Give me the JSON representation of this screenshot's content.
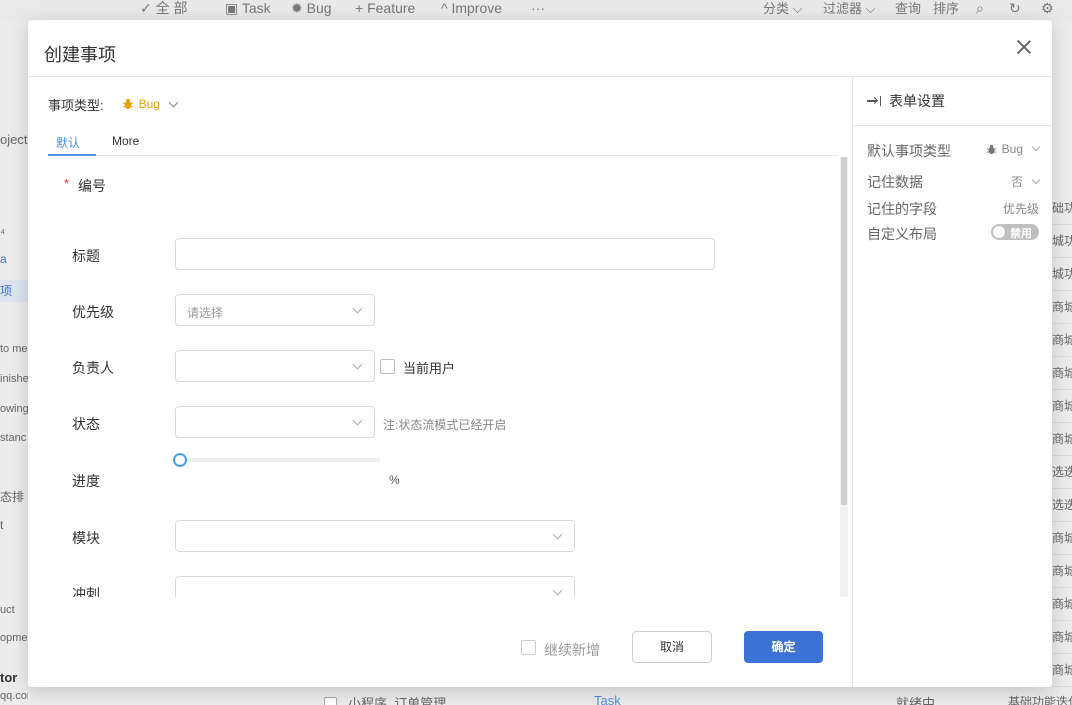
{
  "background": {
    "toolbar_items": [
      {
        "label": "全 部",
        "icon": "check-all-icon"
      },
      {
        "label": "Task",
        "icon": "clipboard-icon"
      },
      {
        "label": "Bug",
        "icon": "bug-icon"
      },
      {
        "label": "Feature",
        "icon": "plus-icon"
      },
      {
        "label": "Improve",
        "icon": "caret-up-icon"
      },
      {
        "label": "···",
        "icon": "more-icon"
      }
    ],
    "toolbar_right": [
      "分类",
      "过滤器",
      "查询",
      "排序"
    ],
    "left_items": [
      "oject",
      "⁴",
      "a",
      "项",
      "to me",
      "inishe",
      "owing",
      "stanc",
      "态排",
      "t",
      "uct",
      "opme",
      "tor",
      "qq.com"
    ],
    "right_items": [
      "础功能",
      "城功能",
      "城功能",
      "商城项",
      "商城项",
      "商城项",
      "商城项",
      "商城项",
      "选迭代",
      "选迭代",
      "商城项",
      "商城项",
      "商城项",
      "商城项",
      "商城项"
    ],
    "bottom_row": {
      "title": "小程序_订单管理",
      "type": "Task",
      "status": "就绪中",
      "module": "基础功能迭代"
    }
  },
  "modal": {
    "title": "创建事项",
    "type_label": "事项类型:",
    "type_value": "Bug",
    "tabs": [
      {
        "label": "默认",
        "active": true
      },
      {
        "label": "More",
        "active": false
      }
    ],
    "fields": {
      "bianhao": {
        "label": "编号",
        "required": true
      },
      "title": {
        "label": "标题",
        "value": ""
      },
      "priority": {
        "label": "优先级",
        "placeholder": "请选择"
      },
      "assignee": {
        "label": "负责人",
        "value": "",
        "checkbox_label": "当前用户"
      },
      "status": {
        "label": "状态",
        "value": "",
        "note": "注:状态流模式已经开启"
      },
      "progress": {
        "label": "进度",
        "value": 0,
        "unit": "%"
      },
      "module": {
        "label": "模块",
        "value": ""
      },
      "sprint": {
        "label": "冲刺",
        "value": ""
      }
    },
    "footer": {
      "continue_label": "继续新增",
      "cancel_label": "取消",
      "ok_label": "确定"
    },
    "settings": {
      "title": "表单设置",
      "rows": [
        {
          "label": "默认事项类型",
          "value": "Bug"
        },
        {
          "label": "记住数据",
          "value": "否"
        },
        {
          "label": "记住的字段",
          "value": "优先级"
        },
        {
          "label": "自定义布局",
          "toggle_label": "禁用",
          "toggle_on": false
        }
      ]
    },
    "colors": {
      "primary": "#3c72d4",
      "accent": "#4a8fe8",
      "bug": "#e6a10a",
      "required": "#e53935"
    }
  }
}
